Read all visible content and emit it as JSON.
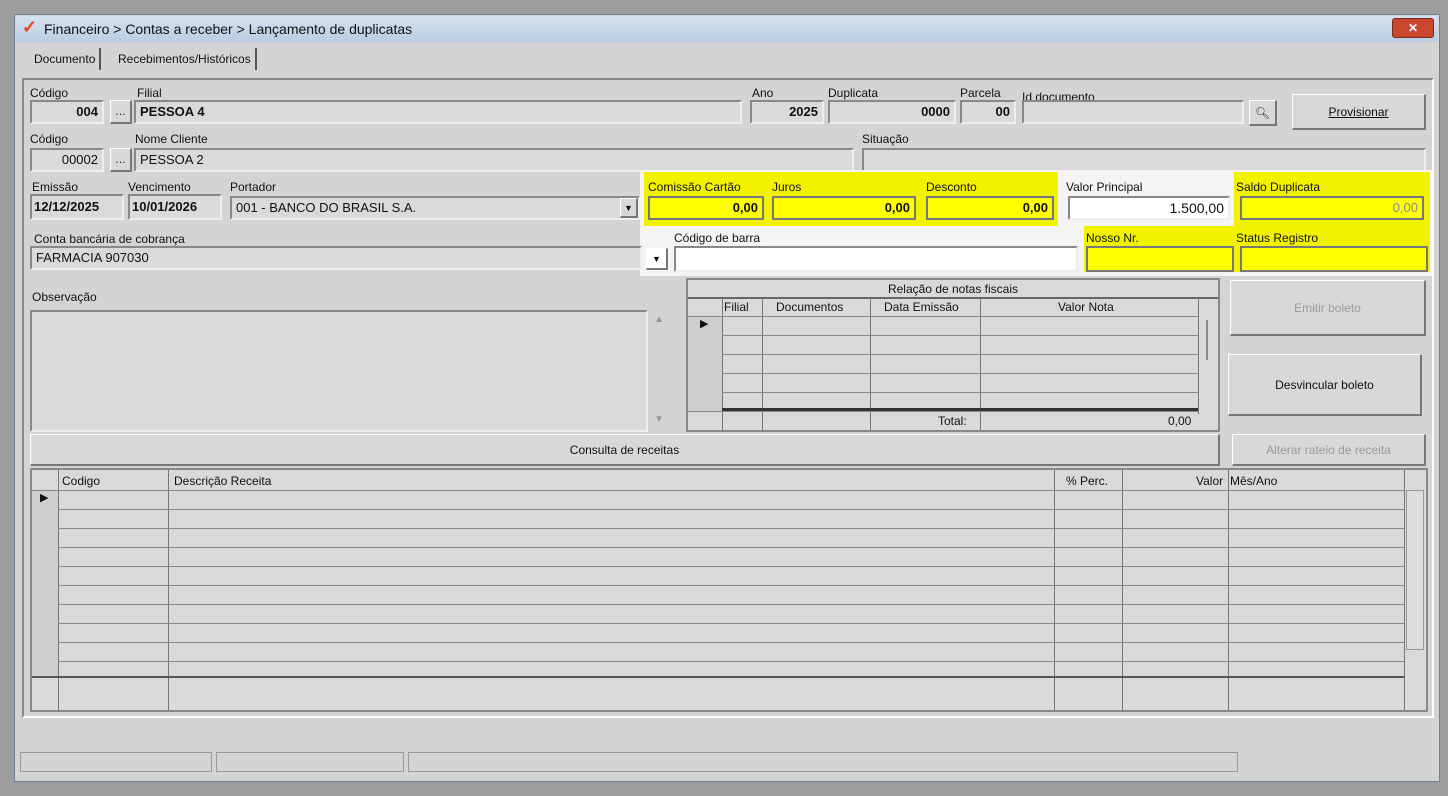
{
  "window": {
    "title": "Financeiro > Contas a receber > Lançamento de duplicatas",
    "close": "✕"
  },
  "tabs": [
    "Documento",
    "Recebimentos/Históricos"
  ],
  "filial": {
    "codigo_label": "Código",
    "codigo": "004",
    "nome_label": "Filial",
    "nome": "PESSOA 4"
  },
  "ano": {
    "label": "Ano",
    "value": "2025"
  },
  "duplicata": {
    "label": "Duplicata",
    "value": "0000"
  },
  "parcela": {
    "label": "Parcela",
    "value": "00"
  },
  "id_documento": {
    "label": "Id documento",
    "value": ""
  },
  "provisionar": "Provisionar",
  "cliente": {
    "codigo_label": "Código",
    "codigo": "00002",
    "nome_label": "Nome Cliente",
    "nome": "PESSOA 2"
  },
  "situacao": {
    "label": "Situação",
    "value": ""
  },
  "emissao": {
    "label": "Emissão",
    "value": "12/12/2025"
  },
  "vencimento": {
    "label": "Vencimento",
    "value": "10/01/2026"
  },
  "portador": {
    "label": "Portador",
    "value": "001 - BANCO DO BRASIL S.A."
  },
  "comissao": {
    "label": "Comissão Cartão",
    "value": "0,00"
  },
  "juros": {
    "label": "Juros",
    "value": "0,00"
  },
  "desconto": {
    "label": "Desconto",
    "value": "0,00"
  },
  "valor_principal": {
    "label": "Valor Principal",
    "value": "1.500,00"
  },
  "saldo": {
    "label": "Saldo Duplicata",
    "value": "0,00"
  },
  "conta": {
    "label": "Conta bancária de cobrança",
    "value": "FARMACIA 907030"
  },
  "codigo_barra": {
    "label": "Código de barra",
    "value": ""
  },
  "nosso_nr": {
    "label": "Nosso Nr.",
    "value": ""
  },
  "status_registro": {
    "label": "Status Registro",
    "value": ""
  },
  "observacao": {
    "label": "Observação",
    "value": ""
  },
  "notas": {
    "title": "Relação de notas fiscais",
    "columns": [
      "Filial",
      "Documentos",
      "Data Emissão",
      "Valor Nota"
    ],
    "total_label": "Total:",
    "total": "0,00"
  },
  "buttons": {
    "emitir": "Emitir boleto",
    "desvincular": "Desvincular boleto",
    "consulta": "Consulta de receitas",
    "alterar": "Alterar rateio de receita"
  },
  "receitas": {
    "columns": [
      "Codigo",
      "Descrição Receita",
      "% Perc.",
      "Valor",
      "Mês/Ano"
    ]
  },
  "colors": {
    "highlight": "#ffff00",
    "accent": "#e8401c"
  }
}
